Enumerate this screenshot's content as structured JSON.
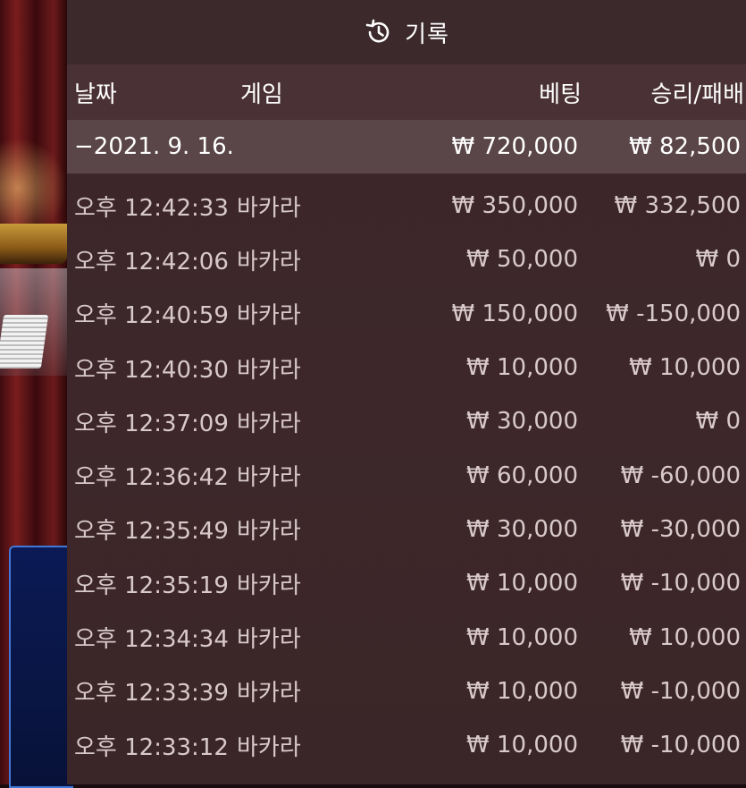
{
  "header": {
    "title": "기록",
    "icon": "history-icon"
  },
  "columns": {
    "date": "날짜",
    "game": "게임",
    "bet": "베팅",
    "win_loss": "승리/패배"
  },
  "date_group": {
    "date": "−2021. 9. 16.",
    "bet_total": "₩ 720,000",
    "win_total": "₩ 82,500"
  },
  "rows": [
    {
      "time": "오후 12:42:33",
      "game": "바카라",
      "bet": "₩ 350,000",
      "win": "₩ 332,500"
    },
    {
      "time": "오후 12:42:06",
      "game": "바카라",
      "bet": "₩ 50,000",
      "win": "₩ 0"
    },
    {
      "time": "오후 12:40:59",
      "game": "바카라",
      "bet": "₩ 150,000",
      "win": "₩ -150,000"
    },
    {
      "time": "오후 12:40:30",
      "game": "바카라",
      "bet": "₩ 10,000",
      "win": "₩ 10,000"
    },
    {
      "time": "오후 12:37:09",
      "game": "바카라",
      "bet": "₩ 30,000",
      "win": "₩ 0"
    },
    {
      "time": "오후 12:36:42",
      "game": "바카라",
      "bet": "₩ 60,000",
      "win": "₩ -60,000"
    },
    {
      "time": "오후 12:35:49",
      "game": "바카라",
      "bet": "₩ 30,000",
      "win": "₩ -30,000"
    },
    {
      "time": "오후 12:35:19",
      "game": "바카라",
      "bet": "₩ 10,000",
      "win": "₩ -10,000"
    },
    {
      "time": "오후 12:34:34",
      "game": "바카라",
      "bet": "₩ 10,000",
      "win": "₩ 10,000"
    },
    {
      "time": "오후 12:33:39",
      "game": "바카라",
      "bet": "₩ 10,000",
      "win": "₩ -10,000"
    },
    {
      "time": "오후 12:33:12",
      "game": "바카라",
      "bet": "₩ 10,000",
      "win": "₩ -10,000"
    }
  ]
}
